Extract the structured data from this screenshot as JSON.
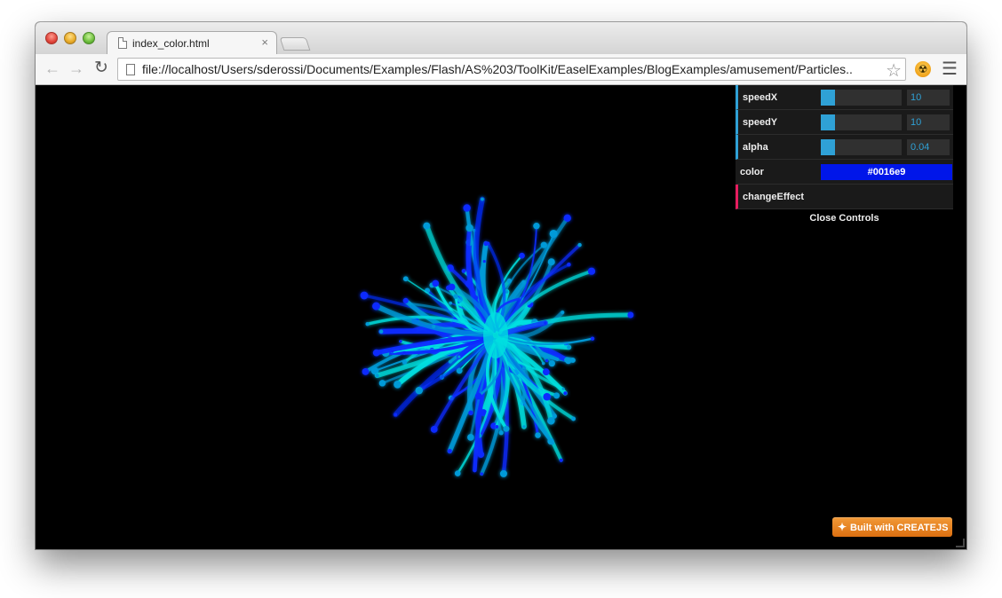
{
  "browser": {
    "tab_title": "index_color.html",
    "tab_close": "×",
    "url": "file://localhost/Users/sderossi/Documents/Examples/Flash/AS%203/ToolKit/EaselExamples/BlogExamples/amusement/Particles...",
    "icons": {
      "back": "back-arrow-icon",
      "forward": "forward-arrow-icon",
      "reload": "reload-icon",
      "bookmark": "star-icon",
      "extension": "extension-icon",
      "menu": "hamburger-menu-icon"
    }
  },
  "gui": {
    "controls": [
      {
        "label": "speedX",
        "value": "10",
        "level": 0.18
      },
      {
        "label": "speedY",
        "value": "10",
        "level": 0.18
      },
      {
        "label": "alpha",
        "value": "0.04",
        "level": 0.18
      }
    ],
    "color": {
      "label": "color",
      "value": "#0016e9"
    },
    "function": {
      "label": "changeEffect"
    },
    "close_label": "Close Controls",
    "colors": {
      "number_accent": "#2fa1d6",
      "function_accent": "#e61d5f"
    }
  },
  "badge": {
    "text": "Built with CREATEJS"
  },
  "palette": {
    "particle_core": "#00e0e0",
    "particle_mid": "#009ad8",
    "particle_edge": "#0a2cff"
  }
}
